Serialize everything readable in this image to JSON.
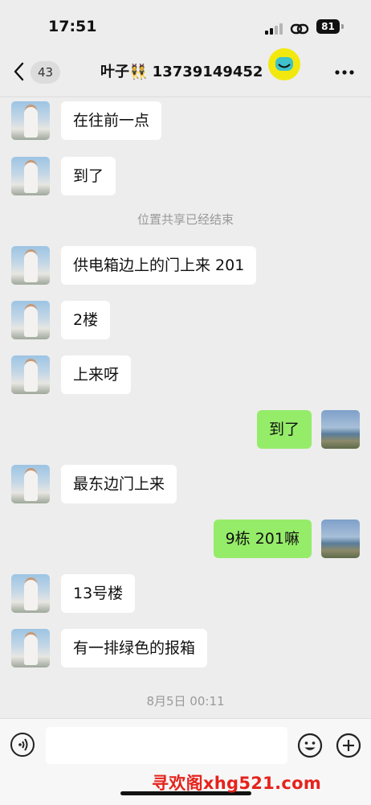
{
  "status_bar": {
    "time": "17:51",
    "battery": "81"
  },
  "nav": {
    "unread_count": "43",
    "title": "叶子👯 13739149452"
  },
  "messages": [
    {
      "side": "left",
      "text": "在往前一点"
    },
    {
      "side": "left",
      "text": "到了"
    },
    {
      "side": "system",
      "text": "位置共享已经结束"
    },
    {
      "side": "left",
      "text": "供电箱边上的门上来 201"
    },
    {
      "side": "left",
      "text": "2楼"
    },
    {
      "side": "left",
      "text": "上来呀"
    },
    {
      "side": "right",
      "text": "到了"
    },
    {
      "side": "left",
      "text": "最东边门上来"
    },
    {
      "side": "right",
      "text": "9栋 201嘛"
    },
    {
      "side": "left",
      "text": "13号楼"
    },
    {
      "side": "left",
      "text": "有一排绿色的报箱"
    },
    {
      "side": "system",
      "text": "8月5日 00:11"
    }
  ],
  "watermark": "寻欢阁xhg521.com",
  "colors": {
    "background": "#ededed",
    "bubble_outgoing": "#95ec69",
    "bubble_incoming": "#ffffff",
    "watermark": "#e5231c"
  },
  "icons": [
    "back-chevron-icon",
    "more-icon",
    "voice-icon",
    "emoji-icon",
    "plus-icon",
    "signal-icon",
    "link-icon",
    "battery-icon"
  ]
}
